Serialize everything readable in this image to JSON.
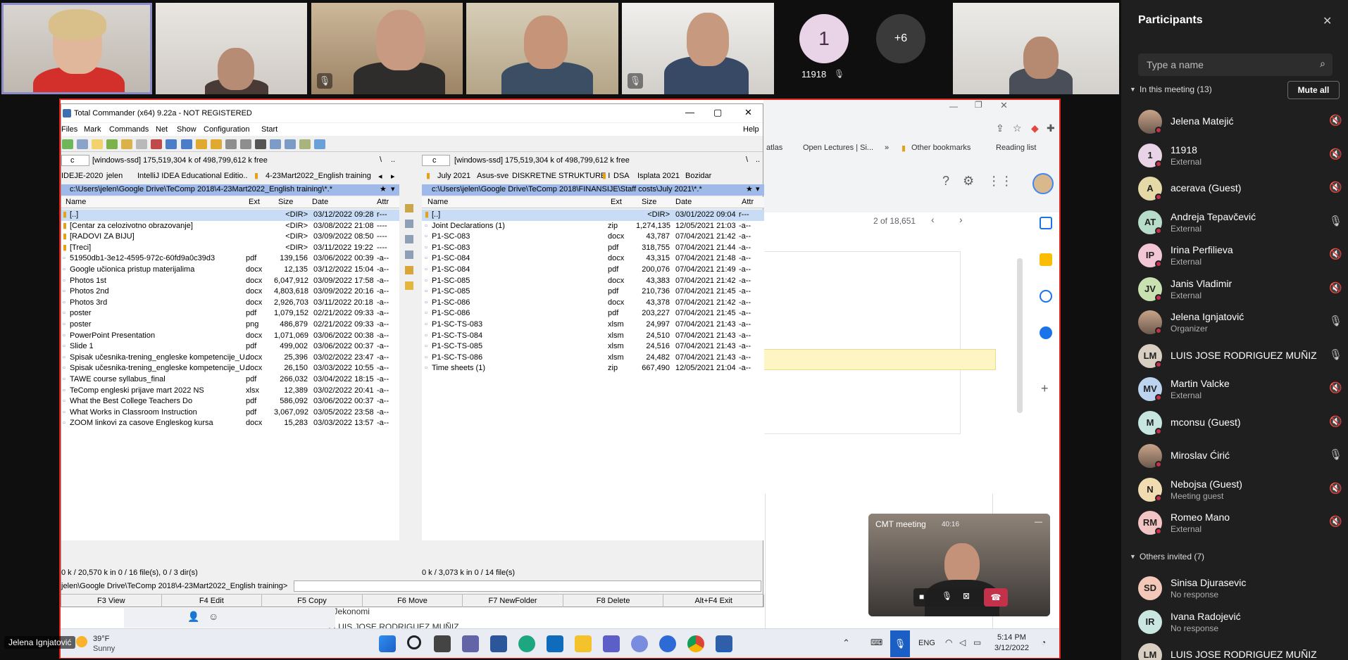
{
  "tiles": {
    "count_label": "1",
    "count_name": "11918",
    "more": "+6"
  },
  "panel": {
    "title": "Participants",
    "search_placeholder": "Type a name",
    "in_meeting": "In this meeting (13)",
    "mute_all": "Mute all",
    "others": "Others invited (7)",
    "participants": [
      {
        "name": "Jelena Matejić",
        "sub": "",
        "initials": "",
        "mic": "off"
      },
      {
        "name": "11918",
        "sub": "External",
        "initials": "1",
        "mic": "off"
      },
      {
        "name": "acerava (Guest)",
        "sub": "",
        "initials": "A",
        "mic": "off"
      },
      {
        "name": "Andreja Tepavčević",
        "sub": "External",
        "initials": "AT",
        "mic": "on"
      },
      {
        "name": "Irina Perfilieva",
        "sub": "External",
        "initials": "IP",
        "mic": "off"
      },
      {
        "name": "Janis Vladimir",
        "sub": "External",
        "initials": "JV",
        "mic": "off"
      },
      {
        "name": "Jelena Ignjatović",
        "sub": "Organizer",
        "initials": "",
        "mic": "on"
      },
      {
        "name": "LUIS JOSE RODRIGUEZ MUÑIZ (...",
        "sub": "",
        "initials": "LM",
        "mic": "on"
      },
      {
        "name": "Martin Valcke",
        "sub": "External",
        "initials": "MV",
        "mic": "off"
      },
      {
        "name": "mconsu (Guest)",
        "sub": "",
        "initials": "M",
        "mic": "off"
      },
      {
        "name": "Miroslav Ćirić",
        "sub": "",
        "initials": "",
        "mic": "on"
      },
      {
        "name": "Nebojsa (Guest)",
        "sub": "Meeting guest",
        "initials": "N",
        "mic": "off"
      },
      {
        "name": "Romeo Mano",
        "sub": "External",
        "initials": "RM",
        "mic": "off"
      }
    ],
    "invited": [
      {
        "name": "Sinisa Djurasevic",
        "sub": "No response",
        "initials": "SD"
      },
      {
        "name": "Ivana Radojević",
        "sub": "No response",
        "initials": "IR"
      },
      {
        "name": "LUIS JOSE RODRIGUEZ MUÑIZ",
        "sub": "",
        "initials": "LM"
      }
    ]
  },
  "tc": {
    "title": "Total Commander (x64) 9.22a - NOT REGISTERED",
    "menu": [
      "Files",
      "Mark",
      "Commands",
      "Net",
      "Show",
      "Configuration",
      "Start"
    ],
    "help": "Help",
    "left": {
      "drive": "c",
      "drive_info": "[windows-ssd]  175,519,304 k of 498,799,612 k free",
      "tabs": [
        "IDEJE-2020",
        "jelen",
        "IntelliJ IDEA Educational Editio..",
        "4-23Mart2022_English training"
      ],
      "path": "c:\\Users\\jelen\\Google Drive\\TeComp 2018\\4-23Mart2022_English training\\*.*",
      "cols": [
        "Name",
        "Ext",
        "Size",
        "Date",
        "Attr"
      ],
      "files": [
        [
          "[..]",
          "",
          "<DIR>",
          "03/12/2022 09:28",
          "r---"
        ],
        [
          "[Centar za celozivotno obrazovanje]",
          "",
          "<DIR>",
          "03/08/2022 21:08",
          "----"
        ],
        [
          "[RADOVI ZA BIJU]",
          "",
          "<DIR>",
          "03/09/2022 08:50",
          "----"
        ],
        [
          "[Treci]",
          "",
          "<DIR>",
          "03/11/2022 19:22",
          "----"
        ],
        [
          "51950db1-3e12-4595-972c-60fd9a0c39d3",
          "pdf",
          "139,156",
          "03/06/2022 00:39",
          "-a--"
        ],
        [
          "Google učionica pristup materijalima",
          "docx",
          "12,135",
          "03/12/2022 15:04",
          "-a--"
        ],
        [
          "Photos 1st",
          "docx",
          "6,047,912",
          "03/09/2022 17:58",
          "-a--"
        ],
        [
          "Photos 2nd",
          "docx",
          "4,803,618",
          "03/09/2022 20:16",
          "-a--"
        ],
        [
          "Photos 3rd",
          "docx",
          "2,926,703",
          "03/11/2022 20:18",
          "-a--"
        ],
        [
          "poster",
          "pdf",
          "1,079,152",
          "02/21/2022 09:33",
          "-a--"
        ],
        [
          "poster",
          "png",
          "486,879",
          "02/21/2022 09:33",
          "-a--"
        ],
        [
          "PowerPoint Presentation",
          "docx",
          "1,071,069",
          "03/06/2022 00:38",
          "-a--"
        ],
        [
          "Slide 1",
          "pdf",
          "499,002",
          "03/06/2022 00:37",
          "-a--"
        ],
        [
          "Spisak učesnika-trening_engleske kompetencije_U..",
          "docx",
          "25,396",
          "03/02/2022 23:47",
          "-a--"
        ],
        [
          "Spisak učesnika-trening_engleske kompetencije_U..",
          "docx",
          "26,150",
          "03/03/2022 10:55",
          "-a--"
        ],
        [
          "TAWE course syllabus_final",
          "pdf",
          "266,032",
          "03/04/2022 18:15",
          "-a--"
        ],
        [
          "TeComp engleski prijave mart 2022 NS",
          "xlsx",
          "12,389",
          "03/02/2022 20:41",
          "-a--"
        ],
        [
          "What the Best College Teachers Do",
          "pdf",
          "586,092",
          "03/06/2022 00:37",
          "-a--"
        ],
        [
          "What Works in Classroom Instruction",
          "pdf",
          "3,067,092",
          "03/05/2022 23:58",
          "-a--"
        ],
        [
          "ZOOM linkovi za casove Engleskog kursa",
          "docx",
          "15,283",
          "03/03/2022 13:57",
          "-a--"
        ]
      ],
      "status": "0 k / 20,570 k in 0 / 16 file(s), 0 / 3 dir(s)"
    },
    "right": {
      "drive": "c",
      "drive_info": "[windows-ssd]  175,519,304 k of 498,799,612 k free",
      "tabs": [
        "July 2021",
        "Asus-sve",
        "DISKRETNE STRUKTURE I",
        "DSA",
        "Isplata 2021",
        "Bozidar"
      ],
      "path": "c:\\Users\\jelen\\Google Drive\\TeComp 2018\\FINANSIJE\\Staff costs\\July 2021\\*.*",
      "cols": [
        "Name",
        "Ext",
        "Size",
        "Date",
        "Attr"
      ],
      "files": [
        [
          "[..]",
          "",
          "<DIR>",
          "03/01/2022 09:04",
          "r---"
        ],
        [
          "Joint Declarations (1)",
          "zip",
          "1,274,135",
          "12/05/2021 21:03",
          "-a--"
        ],
        [
          "P1-SC-083",
          "docx",
          "43,787",
          "07/04/2021 21:42",
          "-a--"
        ],
        [
          "P1-SC-083",
          "pdf",
          "318,755",
          "07/04/2021 21:44",
          "-a--"
        ],
        [
          "P1-SC-084",
          "docx",
          "43,315",
          "07/04/2021 21:48",
          "-a--"
        ],
        [
          "P1-SC-084",
          "pdf",
          "200,076",
          "07/04/2021 21:49",
          "-a--"
        ],
        [
          "P1-SC-085",
          "docx",
          "43,383",
          "07/04/2021 21:42",
          "-a--"
        ],
        [
          "P1-SC-085",
          "pdf",
          "210,736",
          "07/04/2021 21:45",
          "-a--"
        ],
        [
          "P1-SC-086",
          "docx",
          "43,378",
          "07/04/2021 21:42",
          "-a--"
        ],
        [
          "P1-SC-086",
          "pdf",
          "203,227",
          "07/04/2021 21:45",
          "-a--"
        ],
        [
          "P1-SC-TS-083",
          "xlsm",
          "24,997",
          "07/04/2021 21:43",
          "-a--"
        ],
        [
          "P1-SC-TS-084",
          "xlsm",
          "24,510",
          "07/04/2021 21:43",
          "-a--"
        ],
        [
          "P1-SC-TS-085",
          "xlsm",
          "24,516",
          "07/04/2021 21:43",
          "-a--"
        ],
        [
          "P1-SC-TS-086",
          "xlsm",
          "24,482",
          "07/04/2021 21:43",
          "-a--"
        ],
        [
          "Time sheets (1)",
          "zip",
          "667,490",
          "12/05/2021 21:04",
          "-a--"
        ]
      ],
      "status": "0 k / 3,073 k in 0 / 14 file(s)"
    },
    "cmdline": "jelen\\Google Drive\\TeComp 2018\\4-23Mart2022_English training>",
    "fkeys": [
      "F3 View",
      "F4 Edit",
      "F5 Copy",
      "F6 Move",
      "F7 NewFolder",
      "F8 Delete",
      "Alt+F4 Exit"
    ]
  },
  "chrome": {
    "bookmarks": [
      "atlas",
      "Open Lectures | Si...",
      "»",
      "Other bookmarks",
      "Reading list"
    ],
    "count": "2 of 18,651",
    "doc_lines": [
      "Jekonomi",
      "LUIS JOSE RODRIGUEZ MUÑIZ"
    ]
  },
  "mini": {
    "title": "CMT meeting",
    "time": "40:16"
  },
  "presenter": "Jelena Ignjatović",
  "taskbar": {
    "weather_temp": "39°F",
    "weather_desc": "Sunny",
    "lang": "ENG",
    "time": "5:14 PM",
    "date": "3/12/2022"
  },
  "colors": {
    "panel_bg": "#1f1f1f",
    "tc_sel": "#c9dcf5",
    "path_bar": "#9fb9e8",
    "share_border": "#e1251b",
    "accent": "#6264a7"
  }
}
